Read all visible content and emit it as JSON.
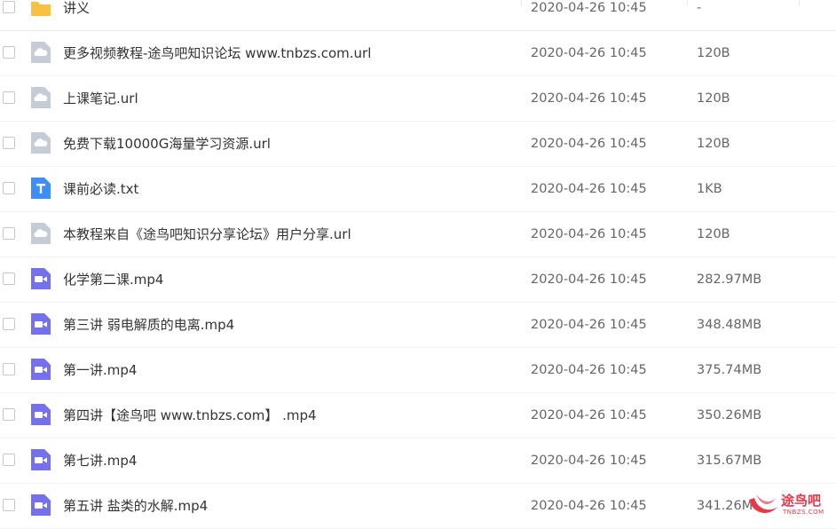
{
  "files": [
    {
      "name": "讲义",
      "date": "2020-04-26 10:45",
      "size": "-",
      "icon": "folder-icon"
    },
    {
      "name": "更多视频教程-途鸟吧知识论坛 www.tnbzs.com.url",
      "date": "2020-04-26 10:45",
      "size": "120B",
      "icon": "link-file-icon"
    },
    {
      "name": "上课笔记.url",
      "date": "2020-04-26 10:45",
      "size": "120B",
      "icon": "link-file-icon"
    },
    {
      "name": "免费下载10000G海量学习资源.url",
      "date": "2020-04-26 10:45",
      "size": "120B",
      "icon": "link-file-icon"
    },
    {
      "name": "课前必读.txt",
      "date": "2020-04-26 10:45",
      "size": "1KB",
      "icon": "text-file-icon"
    },
    {
      "name": "本教程来自《途鸟吧知识分享论坛》用户分享.url",
      "date": "2020-04-26 10:45",
      "size": "120B",
      "icon": "link-file-icon"
    },
    {
      "name": "化学第二课.mp4",
      "date": "2020-04-26 10:45",
      "size": "282.97MB",
      "icon": "video-file-icon"
    },
    {
      "name": "第三讲 弱电解质的电离.mp4",
      "date": "2020-04-26 10:45",
      "size": "348.48MB",
      "icon": "video-file-icon"
    },
    {
      "name": "第一讲.mp4",
      "date": "2020-04-26 10:45",
      "size": "375.74MB",
      "icon": "video-file-icon"
    },
    {
      "name": "第四讲【途鸟吧 www.tnbzs.com】 .mp4",
      "date": "2020-04-26 10:45",
      "size": "350.26MB",
      "icon": "video-file-icon"
    },
    {
      "name": "第七讲.mp4",
      "date": "2020-04-26 10:45",
      "size": "315.67MB",
      "icon": "video-file-icon"
    },
    {
      "name": "第五讲 盐类的水解.mp4",
      "date": "2020-04-26 10:45",
      "size": "341.26M",
      "icon": "video-file-icon"
    }
  ],
  "watermark": {
    "text": "途鸟吧",
    "sub": "TNBZS.COM"
  },
  "colors": {
    "folder": "#f7c244",
    "link": "#c6ccd6",
    "text": "#3d8ef7",
    "video": "#7470ee",
    "watermark": "#e8394a"
  }
}
